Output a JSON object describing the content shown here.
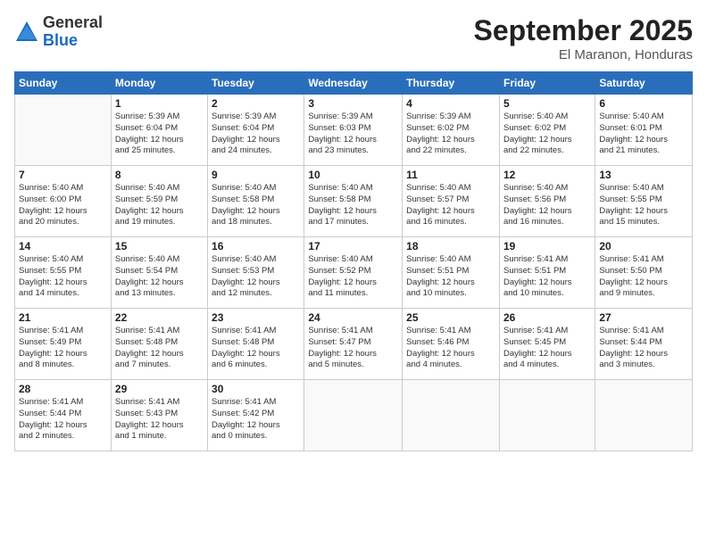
{
  "logo": {
    "general": "General",
    "blue": "Blue"
  },
  "title": "September 2025",
  "location": "El Maranon, Honduras",
  "days_header": [
    "Sunday",
    "Monday",
    "Tuesday",
    "Wednesday",
    "Thursday",
    "Friday",
    "Saturday"
  ],
  "weeks": [
    [
      {
        "day": "",
        "info": ""
      },
      {
        "day": "1",
        "info": "Sunrise: 5:39 AM\nSunset: 6:04 PM\nDaylight: 12 hours\nand 25 minutes."
      },
      {
        "day": "2",
        "info": "Sunrise: 5:39 AM\nSunset: 6:04 PM\nDaylight: 12 hours\nand 24 minutes."
      },
      {
        "day": "3",
        "info": "Sunrise: 5:39 AM\nSunset: 6:03 PM\nDaylight: 12 hours\nand 23 minutes."
      },
      {
        "day": "4",
        "info": "Sunrise: 5:39 AM\nSunset: 6:02 PM\nDaylight: 12 hours\nand 22 minutes."
      },
      {
        "day": "5",
        "info": "Sunrise: 5:40 AM\nSunset: 6:02 PM\nDaylight: 12 hours\nand 22 minutes."
      },
      {
        "day": "6",
        "info": "Sunrise: 5:40 AM\nSunset: 6:01 PM\nDaylight: 12 hours\nand 21 minutes."
      }
    ],
    [
      {
        "day": "7",
        "info": "Sunrise: 5:40 AM\nSunset: 6:00 PM\nDaylight: 12 hours\nand 20 minutes."
      },
      {
        "day": "8",
        "info": "Sunrise: 5:40 AM\nSunset: 5:59 PM\nDaylight: 12 hours\nand 19 minutes."
      },
      {
        "day": "9",
        "info": "Sunrise: 5:40 AM\nSunset: 5:58 PM\nDaylight: 12 hours\nand 18 minutes."
      },
      {
        "day": "10",
        "info": "Sunrise: 5:40 AM\nSunset: 5:58 PM\nDaylight: 12 hours\nand 17 minutes."
      },
      {
        "day": "11",
        "info": "Sunrise: 5:40 AM\nSunset: 5:57 PM\nDaylight: 12 hours\nand 16 minutes."
      },
      {
        "day": "12",
        "info": "Sunrise: 5:40 AM\nSunset: 5:56 PM\nDaylight: 12 hours\nand 16 minutes."
      },
      {
        "day": "13",
        "info": "Sunrise: 5:40 AM\nSunset: 5:55 PM\nDaylight: 12 hours\nand 15 minutes."
      }
    ],
    [
      {
        "day": "14",
        "info": "Sunrise: 5:40 AM\nSunset: 5:55 PM\nDaylight: 12 hours\nand 14 minutes."
      },
      {
        "day": "15",
        "info": "Sunrise: 5:40 AM\nSunset: 5:54 PM\nDaylight: 12 hours\nand 13 minutes."
      },
      {
        "day": "16",
        "info": "Sunrise: 5:40 AM\nSunset: 5:53 PM\nDaylight: 12 hours\nand 12 minutes."
      },
      {
        "day": "17",
        "info": "Sunrise: 5:40 AM\nSunset: 5:52 PM\nDaylight: 12 hours\nand 11 minutes."
      },
      {
        "day": "18",
        "info": "Sunrise: 5:40 AM\nSunset: 5:51 PM\nDaylight: 12 hours\nand 10 minutes."
      },
      {
        "day": "19",
        "info": "Sunrise: 5:41 AM\nSunset: 5:51 PM\nDaylight: 12 hours\nand 10 minutes."
      },
      {
        "day": "20",
        "info": "Sunrise: 5:41 AM\nSunset: 5:50 PM\nDaylight: 12 hours\nand 9 minutes."
      }
    ],
    [
      {
        "day": "21",
        "info": "Sunrise: 5:41 AM\nSunset: 5:49 PM\nDaylight: 12 hours\nand 8 minutes."
      },
      {
        "day": "22",
        "info": "Sunrise: 5:41 AM\nSunset: 5:48 PM\nDaylight: 12 hours\nand 7 minutes."
      },
      {
        "day": "23",
        "info": "Sunrise: 5:41 AM\nSunset: 5:48 PM\nDaylight: 12 hours\nand 6 minutes."
      },
      {
        "day": "24",
        "info": "Sunrise: 5:41 AM\nSunset: 5:47 PM\nDaylight: 12 hours\nand 5 minutes."
      },
      {
        "day": "25",
        "info": "Sunrise: 5:41 AM\nSunset: 5:46 PM\nDaylight: 12 hours\nand 4 minutes."
      },
      {
        "day": "26",
        "info": "Sunrise: 5:41 AM\nSunset: 5:45 PM\nDaylight: 12 hours\nand 4 minutes."
      },
      {
        "day": "27",
        "info": "Sunrise: 5:41 AM\nSunset: 5:44 PM\nDaylight: 12 hours\nand 3 minutes."
      }
    ],
    [
      {
        "day": "28",
        "info": "Sunrise: 5:41 AM\nSunset: 5:44 PM\nDaylight: 12 hours\nand 2 minutes."
      },
      {
        "day": "29",
        "info": "Sunrise: 5:41 AM\nSunset: 5:43 PM\nDaylight: 12 hours\nand 1 minute."
      },
      {
        "day": "30",
        "info": "Sunrise: 5:41 AM\nSunset: 5:42 PM\nDaylight: 12 hours\nand 0 minutes."
      },
      {
        "day": "",
        "info": ""
      },
      {
        "day": "",
        "info": ""
      },
      {
        "day": "",
        "info": ""
      },
      {
        "day": "",
        "info": ""
      }
    ]
  ]
}
